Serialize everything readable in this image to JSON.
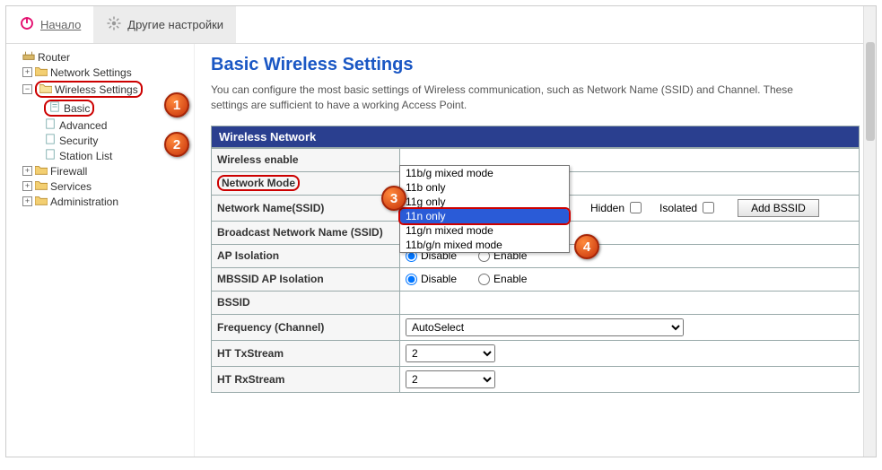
{
  "tabs": {
    "home": "Начало",
    "other": "Другие настройки"
  },
  "tree": {
    "root": "Router",
    "network": "Network Settings",
    "wireless": "Wireless Settings",
    "basic": "Basic",
    "advanced": "Advanced",
    "security": "Security",
    "station": "Station List",
    "firewall": "Firewall",
    "services": "Services",
    "admin": "Administration"
  },
  "page": {
    "title": "Basic Wireless Settings",
    "desc": "You can configure the most basic settings of Wireless communication, such as Network Name (SSID) and Channel. These settings are sufficient to have a working Access Point."
  },
  "panel": {
    "header": "Wireless Network"
  },
  "rows": {
    "wifi_enable": "Wireless enable",
    "net_mode": "Network Mode",
    "ssid": "Network Name(SSID)",
    "broadcast": "Broadcast Network Name (SSID)",
    "ap_iso": "AP Isolation",
    "mbssid_iso": "MBSSID AP Isolation",
    "bssid": "BSSID",
    "freq": "Frequency (Channel)",
    "httx": "HT TxStream",
    "htrx": "HT RxStream"
  },
  "values": {
    "hidden": "Hidden",
    "isolated": "Isolated",
    "add_bssid": "Add BSSID",
    "disable": "Disable",
    "enable": "Enable",
    "freq": "AutoSelect",
    "httx": "2",
    "htrx": "2"
  },
  "net_mode_options": {
    "o1": "11b/g mixed mode",
    "o2": "11b only",
    "o3": "11g only",
    "o4": "11n only",
    "o5": "11g/n mixed mode",
    "o6": "11b/g/n mixed mode"
  },
  "callouts": {
    "c1": "1",
    "c2": "2",
    "c3": "3",
    "c4": "4"
  }
}
